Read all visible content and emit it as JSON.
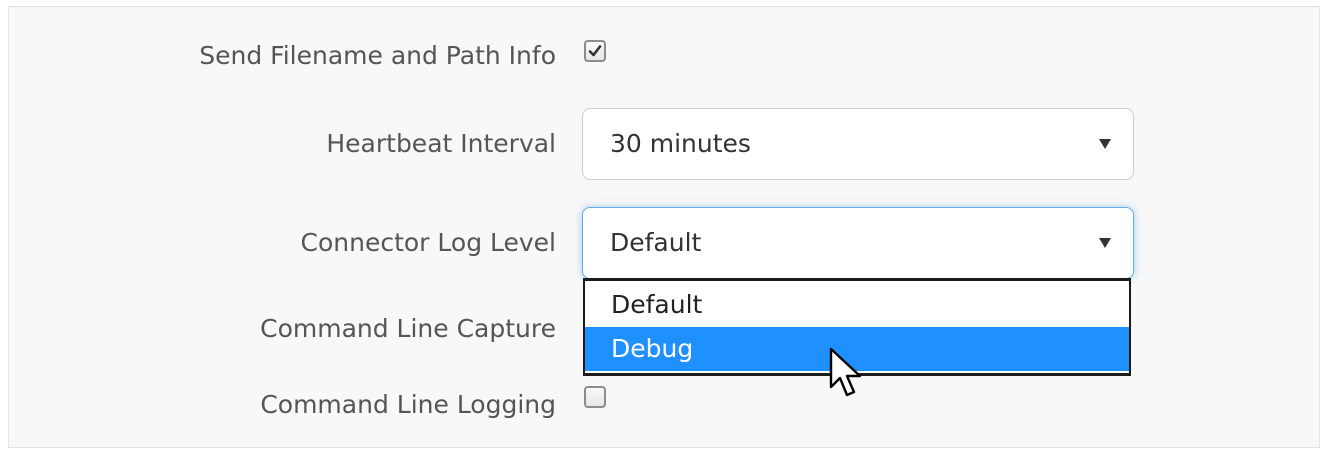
{
  "form": {
    "send_filename": {
      "label": "Send Filename and Path Info",
      "checked": true
    },
    "heartbeat": {
      "label": "Heartbeat Interval",
      "value": "30 minutes"
    },
    "log_level": {
      "label": "Connector Log Level",
      "value": "Default",
      "options": [
        "Default",
        "Debug"
      ],
      "highlighted": "Debug"
    },
    "cmd_capture": {
      "label": "Command Line Capture"
    },
    "cmd_logging": {
      "label": "Command Line Logging",
      "checked": false
    }
  },
  "colors": {
    "highlight": "#1e90ff",
    "focus": "#66afe9",
    "label": "#555555",
    "panel_bg": "#f8f8f8"
  },
  "icons": {
    "caret": "caret-down-icon",
    "check": "check-icon",
    "cursor": "mouse-pointer-icon"
  }
}
